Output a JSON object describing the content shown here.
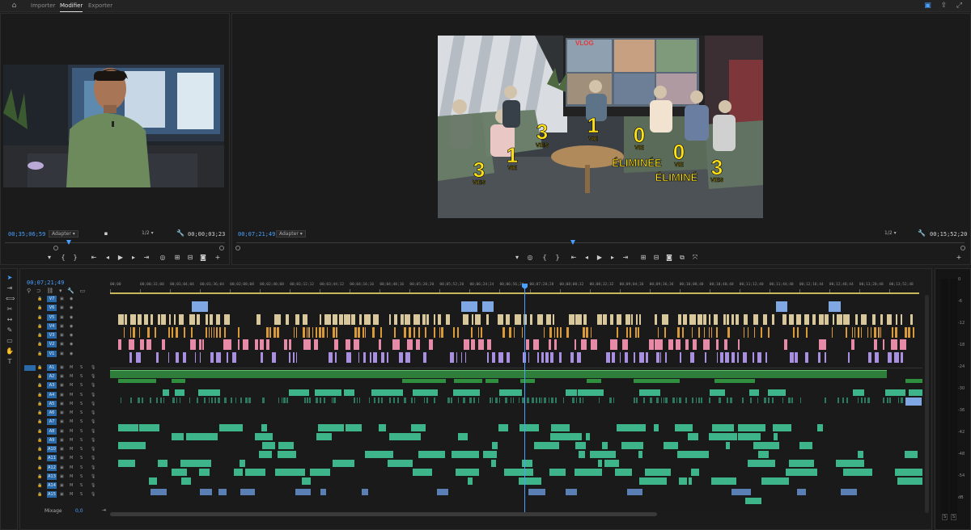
{
  "topbar": {
    "tabs": [
      "Importer",
      "Modifier",
      "Exporter"
    ],
    "active_tab": "Modifier",
    "icons": [
      "home-icon",
      "workspaces-icon",
      "share-icon",
      "fullscreen-icon"
    ]
  },
  "source_monitor": {
    "timecode": "00;35;06;59",
    "fit": "Adapter",
    "resolution": "1/2",
    "duration": "00;00;03;23"
  },
  "program_monitor": {
    "timecode": "00;07;21;49",
    "fit": "Adapter",
    "resolution": "1/2",
    "duration": "00;15;52;20",
    "overlay_labels": [
      {
        "num": "3",
        "word": "VIES"
      },
      {
        "num": "1",
        "word": "VIE"
      },
      {
        "num": "3",
        "word": "VIES"
      },
      {
        "num": "1",
        "word": "VIE"
      },
      {
        "num": "0",
        "word": "VIE"
      },
      {
        "num": "0",
        "word": "VIE"
      },
      {
        "num": "3",
        "word": "VIES"
      }
    ],
    "eliminated": [
      "ÉLIMINÉE",
      "ÉLIMINÉ"
    ],
    "screen_text": "VLOG"
  },
  "timeline": {
    "timecode": "00;07;21;49",
    "ruler": [
      "00;00",
      "00;00;32;00",
      "00;01;04;04",
      "00;01;36;04",
      "00;02;08;08",
      "00;02;40;08",
      "00;03;12;12",
      "00;03;44;12",
      "00;04;16;16",
      "00;04;48;16",
      "00;05;20;20",
      "00;05;52;20",
      "00;06;24;24",
      "00;06;56;24",
      "00;07;28;28",
      "00;08;00;32",
      "00;08;32;32",
      "00;09;04;36",
      "00;09;36;36",
      "00;10;08;40",
      "00;10;40;40",
      "00;11;12;40",
      "00;11;44;40",
      "00;12;16;44",
      "00;12;48;44",
      "00;13;20;48",
      "00;13;52;48"
    ],
    "video_tracks": [
      "V7",
      "V6",
      "V5",
      "V4",
      "V3",
      "V2",
      "V1"
    ],
    "audio_tracks": [
      "A1",
      "A2",
      "A3",
      "A4",
      "A5",
      "A6",
      "A7",
      "A8",
      "A9",
      "A10",
      "A11",
      "A12",
      "A13",
      "A14",
      "A15"
    ],
    "mix_label": "Mixage",
    "mix_value": "0,0",
    "track_buttons": [
      "M",
      "S"
    ]
  },
  "meters": {
    "scale": [
      "0",
      "-6",
      "-12",
      "-18",
      "-24",
      "-30",
      "-36",
      "-42",
      "-48",
      "-54",
      "dB"
    ],
    "bottom": [
      "S",
      "S"
    ]
  },
  "colors": {
    "accent": "#4aa0ff",
    "clip_blue": "#7fa7e3",
    "clip_beige": "#d8c79b",
    "clip_orange": "#d99b3a",
    "clip_pink": "#e68aa8",
    "clip_violet": "#a98fe0",
    "clip_green": "#3db489",
    "clip_dark_green": "#2e7d3a",
    "overlay_yellow": "#ffe21a"
  }
}
